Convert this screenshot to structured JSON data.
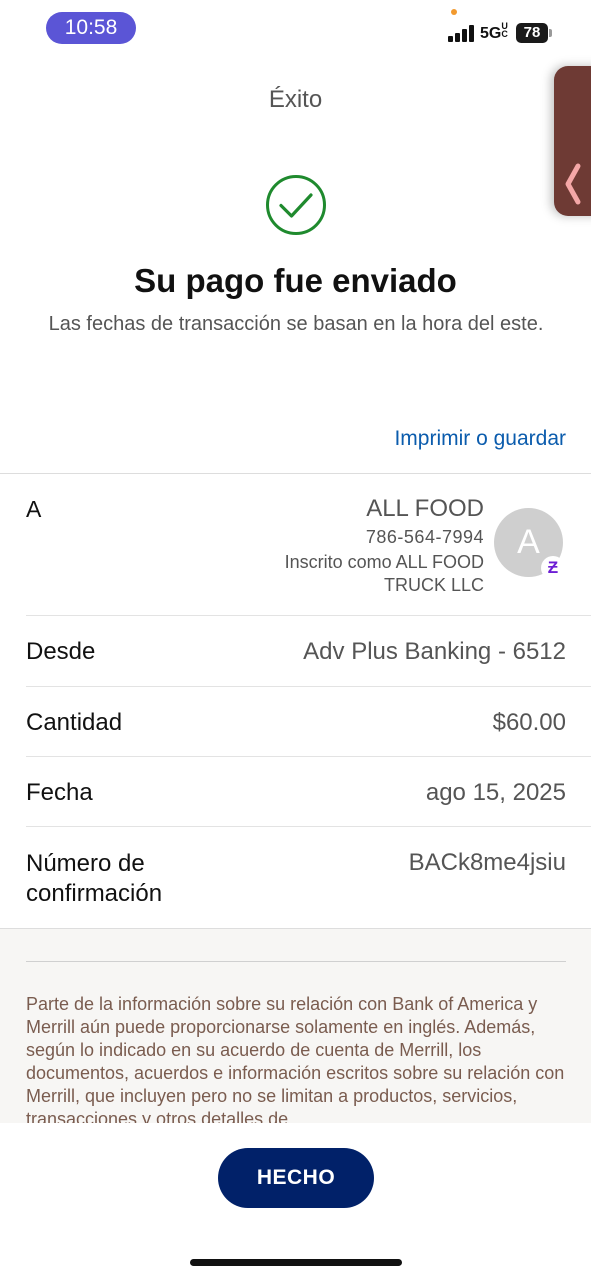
{
  "status_bar": {
    "time": "10:58",
    "network": "5G",
    "network_suffix": "UC",
    "battery": "78"
  },
  "header": {
    "title": "Éxito",
    "headline": "Su pago fue enviado",
    "subtext": "Las fechas de transacción se basan en la hora del este.",
    "print_link": "Imprimir o guardar"
  },
  "recipient": {
    "label": "A",
    "name": "ALL FOOD",
    "phone": "786-564-7994",
    "enrolled": "Inscrito como ALL FOOD TRUCK LLC",
    "avatar_initial": "A",
    "badge_icon": "zelle-icon",
    "badge_glyph": "Ƶ"
  },
  "details": [
    {
      "label": "Desde",
      "value": "Adv Plus Banking - 6512"
    },
    {
      "label": "Cantidad",
      "value": "$60.00"
    },
    {
      "label": "Fecha",
      "value": "ago 15, 2025"
    },
    {
      "label": "Número de confirmación",
      "value": "BACk8me4jsiu"
    }
  ],
  "disclaimer": "Parte de la información sobre su relación con Bank of America y Merrill aún puede proporcionarse solamente en inglés. Además, según lo indicado en su acuerdo de cuenta de Merrill, los documentos, acuerdos e información escritos sobre su relación con Merrill, que incluyen pero no se limitan a productos, servicios, transacciones y otros detalles de",
  "done_button": "HECHO",
  "colors": {
    "brand_navy": "#012169",
    "link_blue": "#0b5cad",
    "success_green": "#1f8a2e",
    "time_pill": "#5b55d6",
    "zelle_purple": "#6d1ed4"
  }
}
